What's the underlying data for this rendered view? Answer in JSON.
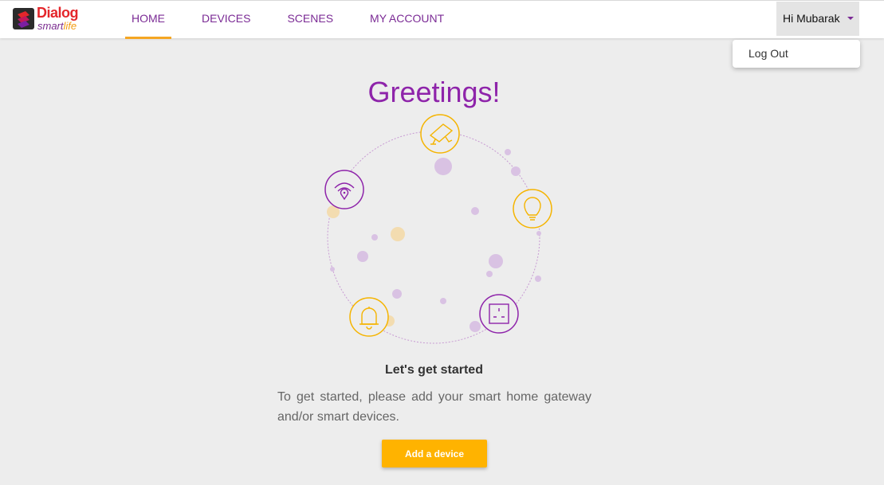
{
  "brand": {
    "name_line1": "Dialog",
    "name_line2_a": "smart",
    "name_line2_b": "life"
  },
  "nav": [
    {
      "label": "HOME",
      "active": true
    },
    {
      "label": "DEVICES",
      "active": false
    },
    {
      "label": "SCENES",
      "active": false
    },
    {
      "label": "MY ACCOUNT",
      "active": false
    }
  ],
  "user": {
    "greeting": "Hi Mubarak",
    "menu_item": "Log Out"
  },
  "main": {
    "title": "Greetings!",
    "subtitle": "Let's get started",
    "description": "To get started, please add your smart home gateway and/or smart devices.",
    "button": "Add a device"
  },
  "illustration_icons": [
    "camera-icon",
    "wifi-location-icon",
    "light-bulb-icon",
    "bell-icon",
    "power-socket-icon"
  ],
  "colors": {
    "purple": "#8e24aa",
    "accent": "#f5a623",
    "button": "#ffb300"
  }
}
